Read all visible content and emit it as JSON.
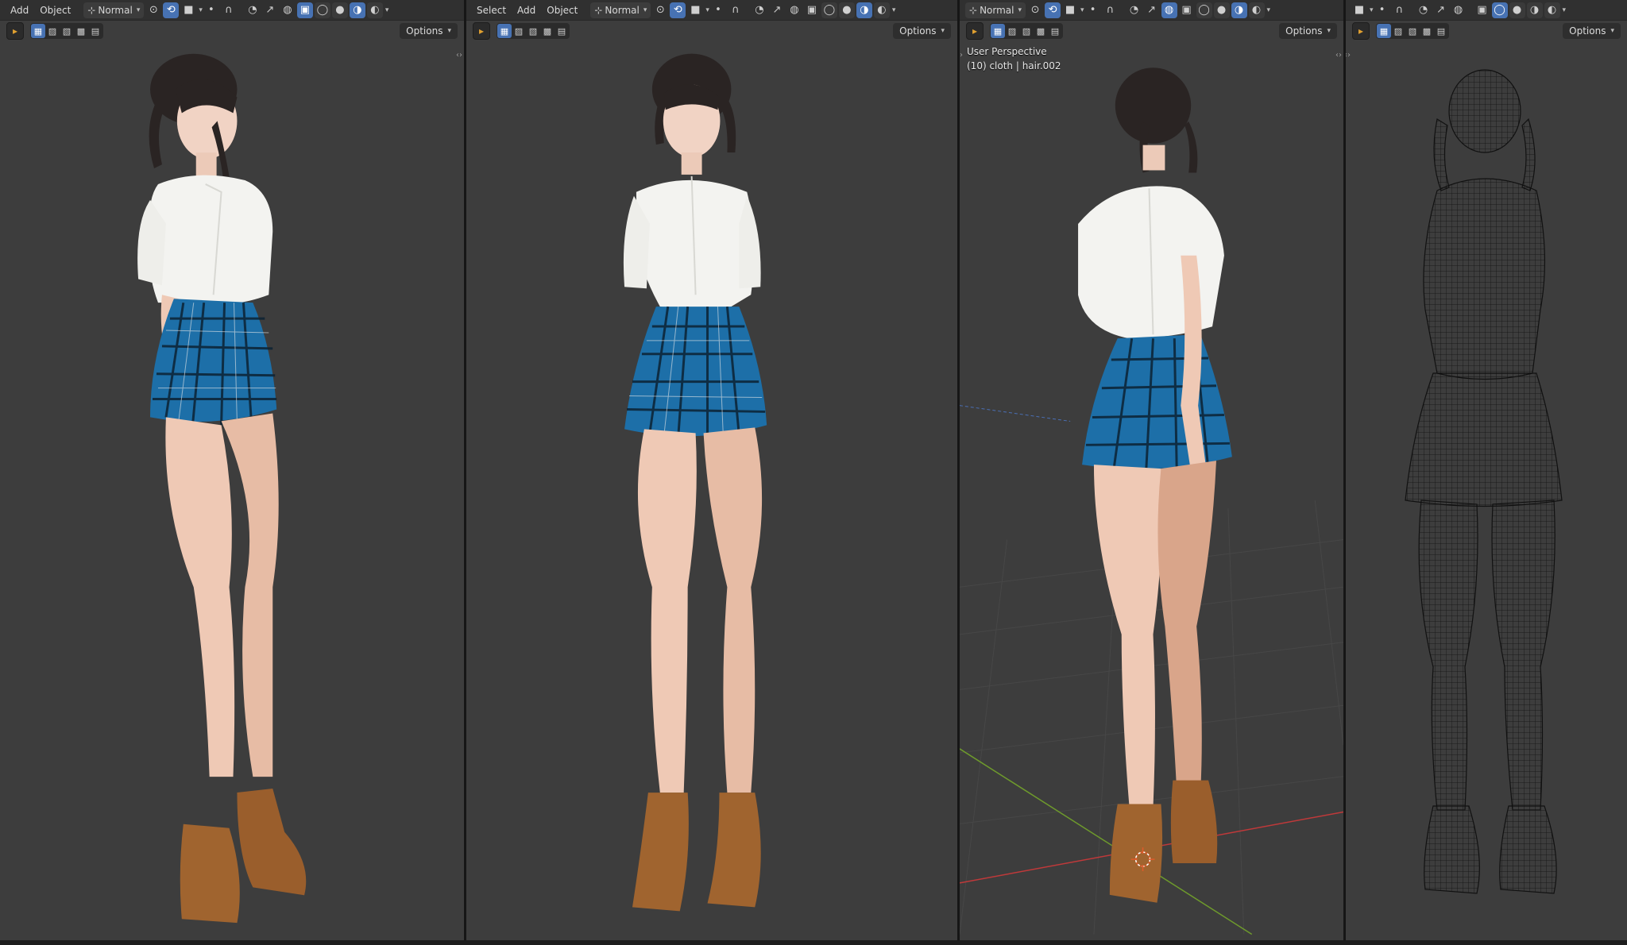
{
  "viewports": [
    {
      "menus": [
        "Add",
        "Object"
      ],
      "orientation": "Normal",
      "options_label": "Options",
      "shading_mode": "solid"
    },
    {
      "menus": [
        "Select",
        "Add",
        "Object"
      ],
      "orientation": "Normal",
      "options_label": "Options",
      "shading_mode": "solid"
    },
    {
      "menus": [],
      "orientation": "Normal",
      "options_label": "Options",
      "overlay_line_1": "User Perspective",
      "overlay_line_2": "(10) cloth | hair.002",
      "shading_mode": "solid"
    },
    {
      "menus": [],
      "orientation": "",
      "options_label": "Options",
      "shading_mode": "wireframe"
    }
  ],
  "icons": {
    "transform_pivot": "pivot-icon",
    "snap": "magnet-icon",
    "proportional": "proportional-icon",
    "overlays": "overlays-icon",
    "xray": "xray-icon",
    "shading": [
      "wireframe-shading-icon",
      "solid-shading-icon",
      "material-shading-icon",
      "rendered-shading-icon"
    ],
    "select_tool": "select-box-icon"
  },
  "colors": {
    "accent": "#4772b3",
    "viewport_bg": "#3d3d3d",
    "header_bg": "#303030",
    "axis_x": "#c0393a",
    "axis_y": "#6e9a2c",
    "skirt": "#1d6fa8",
    "shirt": "#f3f3f0",
    "skin": "#efc9b5",
    "boots": "#a0642f",
    "hair": "#2a2423"
  }
}
